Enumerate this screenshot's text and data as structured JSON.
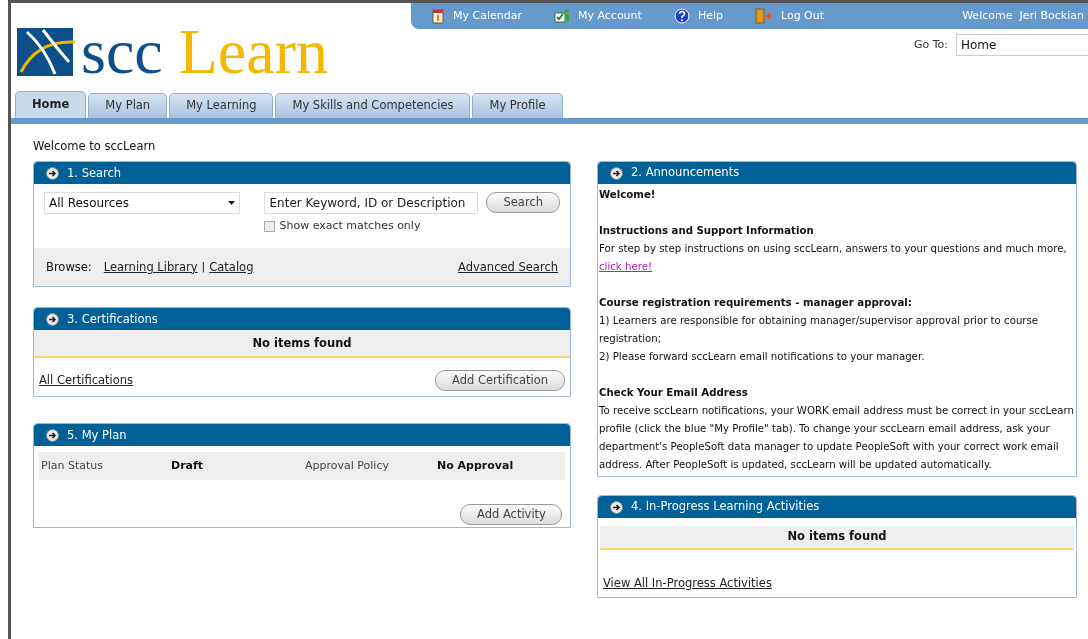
{
  "logo": {
    "word1": "scc",
    "word2": "Learn"
  },
  "top_links": [
    {
      "label": "My Calendar",
      "kind": "calendar"
    },
    {
      "label": "My Account",
      "kind": "account"
    },
    {
      "label": "Help",
      "kind": "help"
    },
    {
      "label": "Log Out",
      "kind": "logout"
    }
  ],
  "welcome_user": "Welcome  Jeri Bockian",
  "goto": {
    "label": "Go To:",
    "value": "Home"
  },
  "tabs": [
    {
      "label": "Home",
      "selected": true
    },
    {
      "label": "My Plan",
      "selected": false
    },
    {
      "label": "My Learning",
      "selected": false
    },
    {
      "label": "My Skills and Competencies",
      "selected": false
    },
    {
      "label": "My Profile",
      "selected": false
    }
  ],
  "page_heading": "Welcome to sccLearn",
  "search_panel": {
    "title": "1. Search",
    "resource_select": "All Resources",
    "keyword_value": "Enter Keyword, ID or Description",
    "search_button": "Search",
    "exact_match": {
      "label": "Show exact matches only",
      "checked": false
    },
    "browse_label": "Browse:",
    "browse_links": [
      "Learning Library",
      "Catalog"
    ],
    "separator": "|",
    "advanced_link": "Advanced Search"
  },
  "certifications_panel": {
    "title": "3. Certifications",
    "empty_message": "No items found",
    "link": "All Certifications",
    "button": "Add Certification"
  },
  "plan_panel": {
    "title": "5. My Plan",
    "fields": [
      {
        "label": "Plan Status",
        "value": "Draft"
      },
      {
        "label": "Approval Policy",
        "value": "No Approval"
      }
    ],
    "button": "Add Activity"
  },
  "announcements_panel": {
    "title": "2. Announcements",
    "sections": [
      {
        "heading": "Welcome!"
      },
      {
        "heading": "Instructions and Support Information",
        "paragraphs": [
          {
            "text": "For step by step instructions on using sccLearn, answers to your questions and much more, ",
            "link": "click here!"
          }
        ]
      },
      {
        "heading": "Course registration requirements - manager approval:",
        "paragraphs": [
          {
            "text": "1) Learners are responsible for obtaining manager/supervisor approval prior to course registration;"
          },
          {
            "text": "2) Please forward sccLearn email notifications to your manager."
          }
        ]
      },
      {
        "heading": "Check Your Email Address",
        "paragraphs": [
          {
            "text": "To receive sccLearn notifications, your WORK email address must be correct in your sccLearn profile (click the blue \"My Profile\" tab). To change your sccLearn email address, ask your department's PeopleSoft data manager to update PeopleSoft with your correct work email address. After PeopleSoft is updated, sccLearn will be updated automatically."
          }
        ]
      }
    ]
  },
  "in_progress_panel": {
    "title": "4. In-Progress Learning Activities",
    "empty_message": "No items found",
    "link": "View All In-Progress Activities"
  }
}
